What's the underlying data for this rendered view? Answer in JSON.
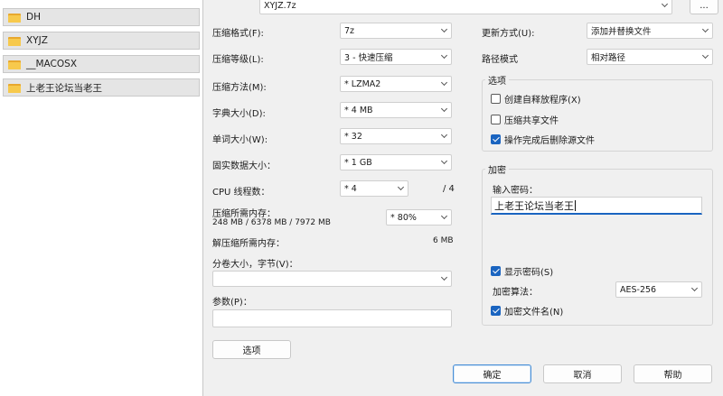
{
  "explorer": {
    "folders": [
      "DH",
      "XYJZ",
      "__MACOSX",
      "上老王论坛当老王"
    ]
  },
  "archive": {
    "name": "XYJZ.7z",
    "browse_label": "..."
  },
  "left": {
    "format_label": "压缩格式(F):",
    "format_value": "7z",
    "level_label": "压缩等级(L):",
    "level_value": "3 - 快速压缩",
    "method_label": "压缩方法(M):",
    "method_value": "* LZMA2",
    "dict_label": "字典大小(D):",
    "dict_value": "* 4 MB",
    "word_label": "单词大小(W):",
    "word_value": "* 32",
    "solid_label": "固实数据大小：",
    "solid_value": "* 1 GB",
    "threads_label": "CPU 线程数：",
    "threads_value": "* 4",
    "threads_total": "/ 4",
    "mem_comp_label": "压缩所需内存：",
    "mem_comp_detail": "248 MB / 6378 MB / 7972 MB",
    "mem_comp_value": "* 80%",
    "mem_decomp_label": "解压缩所需内存：",
    "mem_decomp_value": "6 MB",
    "volume_label": "分卷大小，字节(V)：",
    "volume_value": "",
    "params_label": "参数(P)：",
    "params_value": "",
    "options_button": "选项"
  },
  "right": {
    "update_label": "更新方式(U):",
    "update_value": "添加并替换文件",
    "path_label": "路径模式",
    "path_value": "相对路径",
    "options_group": "选项",
    "sfx_label": "创建自释放程序(X)",
    "sfx_checked": false,
    "shared_label": "压缩共享文件",
    "shared_checked": false,
    "delete_label": "操作完成后删除源文件",
    "delete_checked": true,
    "encrypt_group": "加密",
    "password_label": "输入密码：",
    "password_value": "上老王论坛当老王",
    "show_pwd_label": "显示密码(S)",
    "show_pwd_checked": true,
    "algo_label": "加密算法：",
    "algo_value": "AES-256",
    "encrypt_names_label": "加密文件名(N)",
    "encrypt_names_checked": true
  },
  "buttons": {
    "ok": "确定",
    "cancel": "取消",
    "help": "帮助"
  }
}
